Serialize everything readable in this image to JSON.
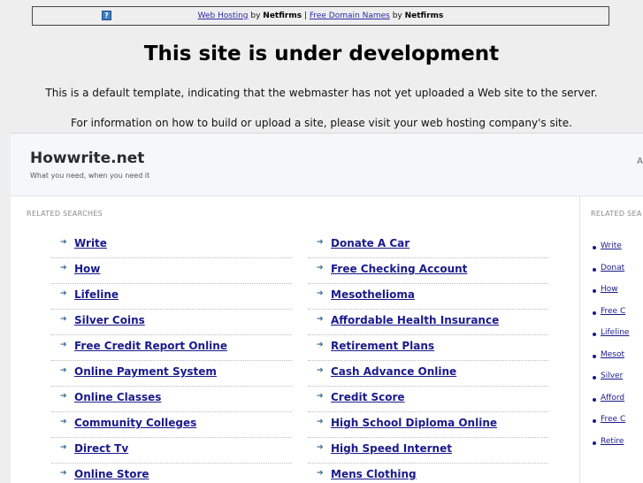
{
  "banner": {
    "badge_icon": "?",
    "link1": "Web Hosting",
    "by1": " by ",
    "brand1": "Netfirms",
    "sep": " | ",
    "link2": "Free Domain Names",
    "by2": " by ",
    "brand2": "Netfirms"
  },
  "dev": {
    "title": "This site is under development",
    "line1": "This is a default template, indicating that the webmaster has not yet uploaded a Web site to the server.",
    "line2": "For information on how to build or upload a site, please visit your web hosting company's site."
  },
  "site": {
    "name": "Howwrite.net",
    "tagline": "What you need, when you need it",
    "header_glyph": "A"
  },
  "main": {
    "label": "RELATED SEARCHES",
    "left": [
      "Write",
      "How",
      "Lifeline",
      "Silver Coins",
      "Free Credit Report Online",
      "Online Payment System",
      "Online Classes",
      "Community Colleges",
      "Direct Tv",
      "Online Store"
    ],
    "right": [
      "Donate A Car",
      "Free Checking Account",
      "Mesothelioma",
      "Affordable Health Insurance",
      "Retirement Plans",
      "Cash Advance Online",
      "Credit Score",
      "High School Diploma Online",
      "High Speed Internet",
      "Mens Clothing"
    ]
  },
  "side": {
    "label": "RELATED SEA",
    "items": [
      "Write",
      "Donat",
      "How",
      "Free C",
      "Lifeline",
      "Mesot",
      "Silver",
      "Afford",
      "Free C",
      "Retire"
    ]
  },
  "colors": {
    "link": "#1a1a8c",
    "arrow": "#2e6a8a",
    "header_bg": "#f4f8fb",
    "page_bg": "#eeeeee"
  },
  "icons": {
    "arrow": "arrow-right-icon",
    "bullet": "bullet-dot-icon"
  }
}
